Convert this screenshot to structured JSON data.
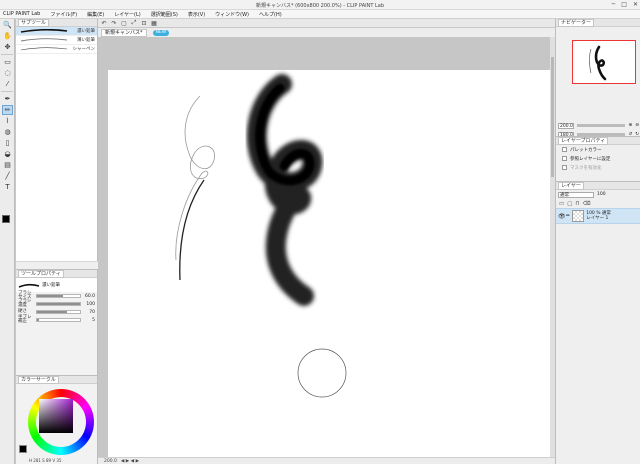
{
  "window": {
    "title": "新規キャンバス* (600x800 200.0%) - CLIP PAINT Lab",
    "controls": [
      "─",
      "□",
      "✕"
    ]
  },
  "menu": {
    "app": "CLIP PAINT Lab",
    "items": [
      "ファイル(F)",
      "編集(E)",
      "レイヤー(L)",
      "選択範囲(S)",
      "表示(V)",
      "ウィンドウ(W)",
      "ヘルプ(H)"
    ]
  },
  "tools": [
    {
      "icon": "zoom-icon",
      "glyph": "🔍"
    },
    {
      "icon": "hand-icon",
      "glyph": "✋"
    },
    {
      "icon": "move-icon",
      "glyph": "✥"
    },
    {
      "icon": "select-rect-icon",
      "glyph": "▭"
    },
    {
      "icon": "lasso-icon",
      "glyph": "◌"
    },
    {
      "icon": "eyedropper-icon",
      "glyph": "⁄"
    },
    {
      "icon": "pen-icon",
      "glyph": "✒"
    },
    {
      "icon": "pencil-icon",
      "glyph": "✏"
    },
    {
      "icon": "brush-icon",
      "glyph": "⌇"
    },
    {
      "icon": "airbrush-icon",
      "glyph": "◍"
    },
    {
      "icon": "eraser-icon",
      "glyph": "▯"
    },
    {
      "icon": "fill-icon",
      "glyph": "◒"
    },
    {
      "icon": "gradient-icon",
      "glyph": "▤"
    },
    {
      "icon": "shape-icon",
      "glyph": "╱"
    },
    {
      "icon": "text-icon",
      "glyph": "T"
    }
  ],
  "subtool": {
    "tabs": [
      "サブツール"
    ],
    "brushes": [
      {
        "name": "濃い鉛筆",
        "selected": true
      },
      {
        "name": "薄い鉛筆",
        "selected": false
      },
      {
        "name": "シャーペン",
        "selected": false
      }
    ]
  },
  "tool_property": {
    "header": "ツールプロパティ",
    "brush": "濃い鉛筆",
    "props": [
      {
        "label": "ブラシサイズ",
        "value": "60.0",
        "fraction": 0.6
      },
      {
        "label": "ブラシ濃度",
        "value": "100",
        "fraction": 1.0
      },
      {
        "label": "硬さ",
        "value": "70",
        "fraction": 0.7
      },
      {
        "label": "手ブレ補正",
        "value": "5",
        "fraction": 0.05
      }
    ]
  },
  "color_wheel": {
    "header": "カラーサークル",
    "readout": "H 281  S 89  V 35"
  },
  "document": {
    "tab": "新規キャンバス*",
    "badge": "NEW"
  },
  "status": {
    "zoom": "200.0",
    "coords": "◀ ▶  ◀ ▶"
  },
  "navigator": {
    "header": "ナビゲーター",
    "zoom": "200.0",
    "rotate": "180.0"
  },
  "layer_property": {
    "header": "レイヤープロパティ",
    "options": [
      {
        "label": "パレットカラー",
        "enabled": true
      },
      {
        "label": "参照レイヤーに設定",
        "enabled": true
      },
      {
        "label": "マスクを有効化",
        "enabled": false
      }
    ]
  },
  "layers": {
    "header": "レイヤー",
    "blend_mode": "通常",
    "opacity": "100",
    "items": [
      {
        "line1": "100 % 通常",
        "line2": "レイヤー 1",
        "selected": true
      }
    ]
  }
}
